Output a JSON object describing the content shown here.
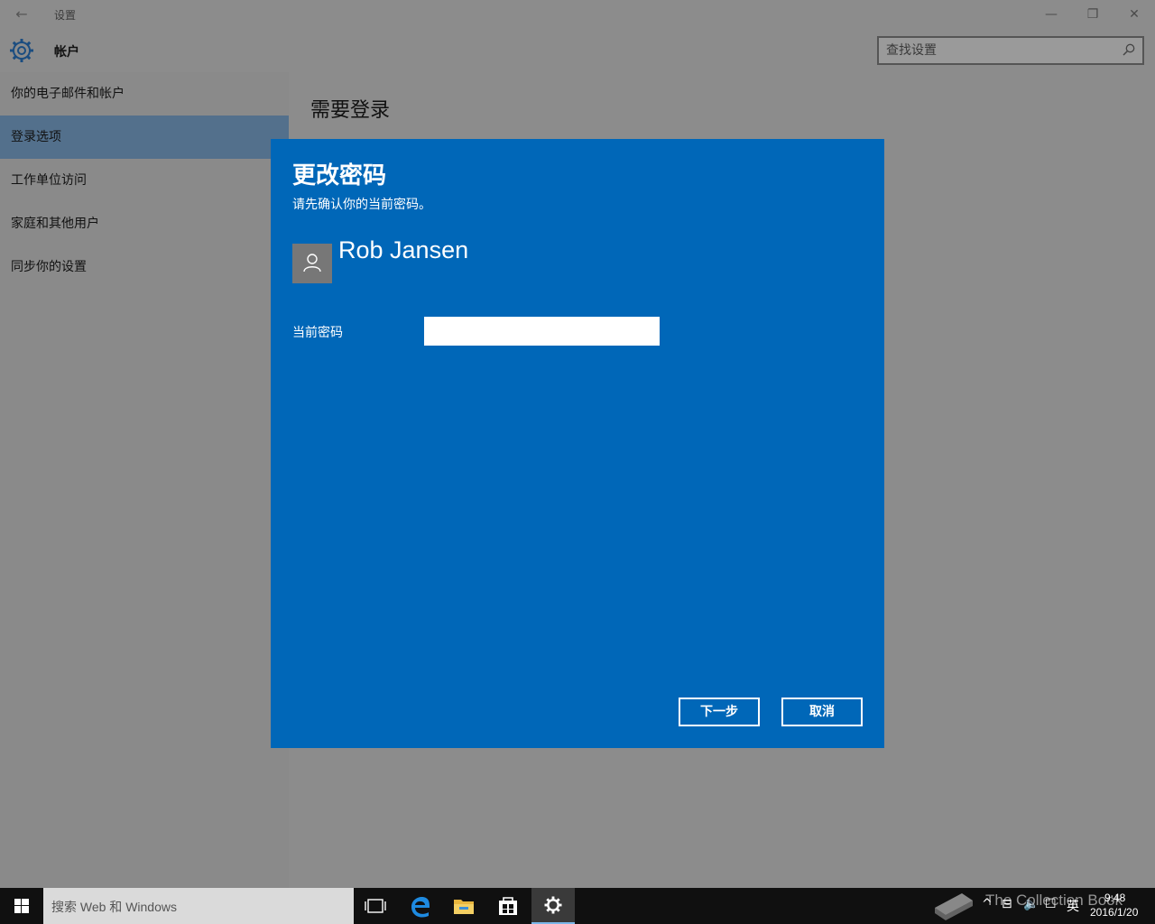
{
  "window": {
    "title": "设置",
    "app_title": "帐户",
    "back_icon": "back-arrow-icon",
    "controls": {
      "minimize": "—",
      "restore": "❐",
      "close": "✕"
    }
  },
  "search": {
    "placeholder": "查找设置"
  },
  "sidebar": {
    "items": [
      {
        "label": "你的电子邮件和帐户",
        "active": false
      },
      {
        "label": "登录选项",
        "active": true
      },
      {
        "label": "工作单位访问",
        "active": false
      },
      {
        "label": "家庭和其他用户",
        "active": false
      },
      {
        "label": "同步你的设置",
        "active": false
      }
    ]
  },
  "content": {
    "heading": "需要登录"
  },
  "dialog": {
    "title": "更改密码",
    "subtitle": "请先确认你的当前密码。",
    "user_name": "Rob Jansen",
    "password_label": "当前密码",
    "password_value": "",
    "next_label": "下一步",
    "cancel_label": "取消"
  },
  "taskbar": {
    "search_placeholder": "搜索 Web 和 Windows",
    "lang": "英",
    "time": "9:48",
    "date": "2016/1/20",
    "watermark": "The Collection Book"
  },
  "colors": {
    "dialog_bg": "#0067b8",
    "sidebar_active": "#53708c",
    "taskbar_bg": "#101010"
  }
}
